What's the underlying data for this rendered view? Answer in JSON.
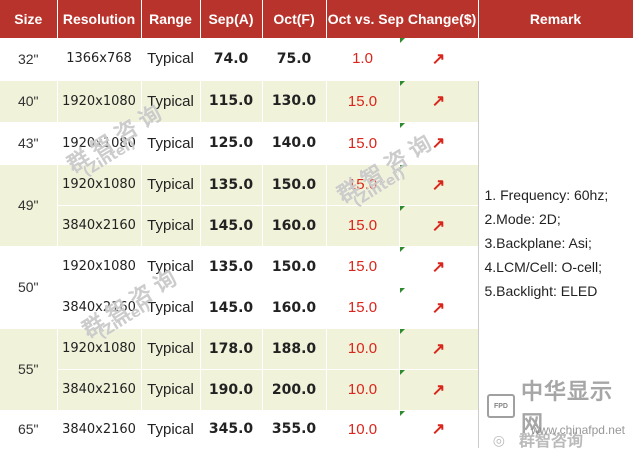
{
  "headers": {
    "size": "Size",
    "resolution": "Resolution",
    "range": "Range",
    "sep": "Sep(A)",
    "oct": "Oct(F)",
    "change": "Oct vs. Sep Change($)",
    "remark": "Remark"
  },
  "rows": [
    {
      "size": "32\"",
      "resolution": "1366x768",
      "range": "Typical",
      "sep": "74.0",
      "oct": "75.0",
      "change": "1.0"
    },
    {
      "size": "40\"",
      "resolution": "1920x1080",
      "range": "Typical",
      "sep": "115.0",
      "oct": "130.0",
      "change": "15.0"
    },
    {
      "size": "43\"",
      "resolution": "1920x1080",
      "range": "Typical",
      "sep": "125.0",
      "oct": "140.0",
      "change": "15.0"
    },
    {
      "size": "49\"",
      "resolution": "1920x1080",
      "range": "Typical",
      "sep": "135.0",
      "oct": "150.0",
      "change": "15.0"
    },
    {
      "size": "",
      "resolution": "3840x2160",
      "range": "Typical",
      "sep": "145.0",
      "oct": "160.0",
      "change": "15.0"
    },
    {
      "size": "50\"",
      "resolution": "1920x1080",
      "range": "Typical",
      "sep": "135.0",
      "oct": "150.0",
      "change": "15.0"
    },
    {
      "size": "",
      "resolution": "3840x2160",
      "range": "Typical",
      "sep": "145.0",
      "oct": "160.0",
      "change": "15.0"
    },
    {
      "size": "55\"",
      "resolution": "1920x1080",
      "range": "Typical",
      "sep": "178.0",
      "oct": "188.0",
      "change": "10.0"
    },
    {
      "size": "",
      "resolution": "3840x2160",
      "range": "Typical",
      "sep": "190.0",
      "oct": "200.0",
      "change": "10.0"
    },
    {
      "size": "65\"",
      "resolution": "3840x2160",
      "range": "Typical",
      "sep": "345.0",
      "oct": "355.0",
      "change": "10.0"
    }
  ],
  "arrow_glyph": "↗",
  "remark": [
    "1. Frequency: 60hz;",
    "2.Mode: 2D;",
    "3.Backplane: Asi;",
    "4.LCM/Cell: O-cell;",
    "5.Backlight: ELED"
  ],
  "watermark": {
    "cn": "群智咨询",
    "en": "(Zintel)"
  },
  "logo": {
    "badge": "FPD",
    "name": "中华显示网",
    "url": "www.chinafpd.net",
    "account": "群智咨询"
  },
  "colors": {
    "header_bg": "#b8332b",
    "band_bg": "#f0f2d9",
    "change_red": "#d9261c"
  }
}
